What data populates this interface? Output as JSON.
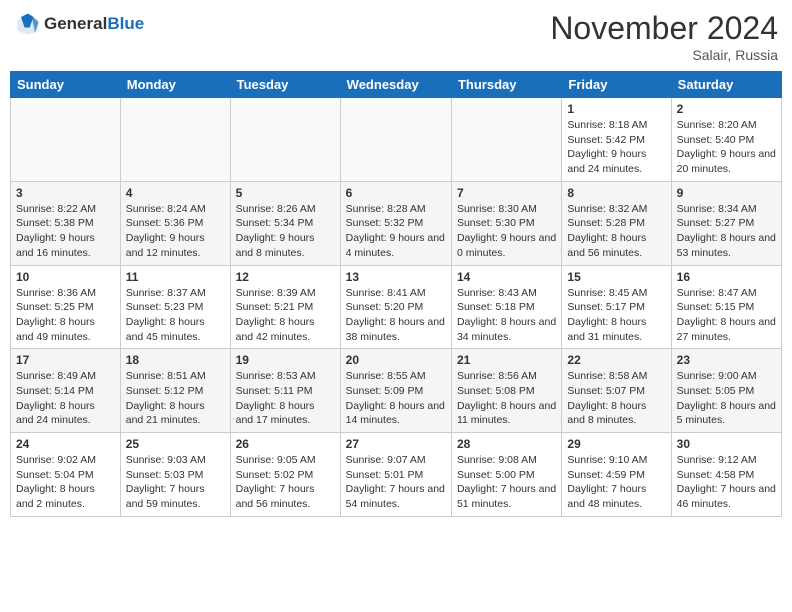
{
  "header": {
    "logo_general": "General",
    "logo_blue": "Blue",
    "month_title": "November 2024",
    "location": "Salair, Russia"
  },
  "days_of_week": [
    "Sunday",
    "Monday",
    "Tuesday",
    "Wednesday",
    "Thursday",
    "Friday",
    "Saturday"
  ],
  "weeks": [
    [
      {
        "day": "",
        "info": ""
      },
      {
        "day": "",
        "info": ""
      },
      {
        "day": "",
        "info": ""
      },
      {
        "day": "",
        "info": ""
      },
      {
        "day": "",
        "info": ""
      },
      {
        "day": "1",
        "info": "Sunrise: 8:18 AM\nSunset: 5:42 PM\nDaylight: 9 hours and 24 minutes."
      },
      {
        "day": "2",
        "info": "Sunrise: 8:20 AM\nSunset: 5:40 PM\nDaylight: 9 hours and 20 minutes."
      }
    ],
    [
      {
        "day": "3",
        "info": "Sunrise: 8:22 AM\nSunset: 5:38 PM\nDaylight: 9 hours and 16 minutes."
      },
      {
        "day": "4",
        "info": "Sunrise: 8:24 AM\nSunset: 5:36 PM\nDaylight: 9 hours and 12 minutes."
      },
      {
        "day": "5",
        "info": "Sunrise: 8:26 AM\nSunset: 5:34 PM\nDaylight: 9 hours and 8 minutes."
      },
      {
        "day": "6",
        "info": "Sunrise: 8:28 AM\nSunset: 5:32 PM\nDaylight: 9 hours and 4 minutes."
      },
      {
        "day": "7",
        "info": "Sunrise: 8:30 AM\nSunset: 5:30 PM\nDaylight: 9 hours and 0 minutes."
      },
      {
        "day": "8",
        "info": "Sunrise: 8:32 AM\nSunset: 5:28 PM\nDaylight: 8 hours and 56 minutes."
      },
      {
        "day": "9",
        "info": "Sunrise: 8:34 AM\nSunset: 5:27 PM\nDaylight: 8 hours and 53 minutes."
      }
    ],
    [
      {
        "day": "10",
        "info": "Sunrise: 8:36 AM\nSunset: 5:25 PM\nDaylight: 8 hours and 49 minutes."
      },
      {
        "day": "11",
        "info": "Sunrise: 8:37 AM\nSunset: 5:23 PM\nDaylight: 8 hours and 45 minutes."
      },
      {
        "day": "12",
        "info": "Sunrise: 8:39 AM\nSunset: 5:21 PM\nDaylight: 8 hours and 42 minutes."
      },
      {
        "day": "13",
        "info": "Sunrise: 8:41 AM\nSunset: 5:20 PM\nDaylight: 8 hours and 38 minutes."
      },
      {
        "day": "14",
        "info": "Sunrise: 8:43 AM\nSunset: 5:18 PM\nDaylight: 8 hours and 34 minutes."
      },
      {
        "day": "15",
        "info": "Sunrise: 8:45 AM\nSunset: 5:17 PM\nDaylight: 8 hours and 31 minutes."
      },
      {
        "day": "16",
        "info": "Sunrise: 8:47 AM\nSunset: 5:15 PM\nDaylight: 8 hours and 27 minutes."
      }
    ],
    [
      {
        "day": "17",
        "info": "Sunrise: 8:49 AM\nSunset: 5:14 PM\nDaylight: 8 hours and 24 minutes."
      },
      {
        "day": "18",
        "info": "Sunrise: 8:51 AM\nSunset: 5:12 PM\nDaylight: 8 hours and 21 minutes."
      },
      {
        "day": "19",
        "info": "Sunrise: 8:53 AM\nSunset: 5:11 PM\nDaylight: 8 hours and 17 minutes."
      },
      {
        "day": "20",
        "info": "Sunrise: 8:55 AM\nSunset: 5:09 PM\nDaylight: 8 hours and 14 minutes."
      },
      {
        "day": "21",
        "info": "Sunrise: 8:56 AM\nSunset: 5:08 PM\nDaylight: 8 hours and 11 minutes."
      },
      {
        "day": "22",
        "info": "Sunrise: 8:58 AM\nSunset: 5:07 PM\nDaylight: 8 hours and 8 minutes."
      },
      {
        "day": "23",
        "info": "Sunrise: 9:00 AM\nSunset: 5:05 PM\nDaylight: 8 hours and 5 minutes."
      }
    ],
    [
      {
        "day": "24",
        "info": "Sunrise: 9:02 AM\nSunset: 5:04 PM\nDaylight: 8 hours and 2 minutes."
      },
      {
        "day": "25",
        "info": "Sunrise: 9:03 AM\nSunset: 5:03 PM\nDaylight: 7 hours and 59 minutes."
      },
      {
        "day": "26",
        "info": "Sunrise: 9:05 AM\nSunset: 5:02 PM\nDaylight: 7 hours and 56 minutes."
      },
      {
        "day": "27",
        "info": "Sunrise: 9:07 AM\nSunset: 5:01 PM\nDaylight: 7 hours and 54 minutes."
      },
      {
        "day": "28",
        "info": "Sunrise: 9:08 AM\nSunset: 5:00 PM\nDaylight: 7 hours and 51 minutes."
      },
      {
        "day": "29",
        "info": "Sunrise: 9:10 AM\nSunset: 4:59 PM\nDaylight: 7 hours and 48 minutes."
      },
      {
        "day": "30",
        "info": "Sunrise: 9:12 AM\nSunset: 4:58 PM\nDaylight: 7 hours and 46 minutes."
      }
    ]
  ]
}
